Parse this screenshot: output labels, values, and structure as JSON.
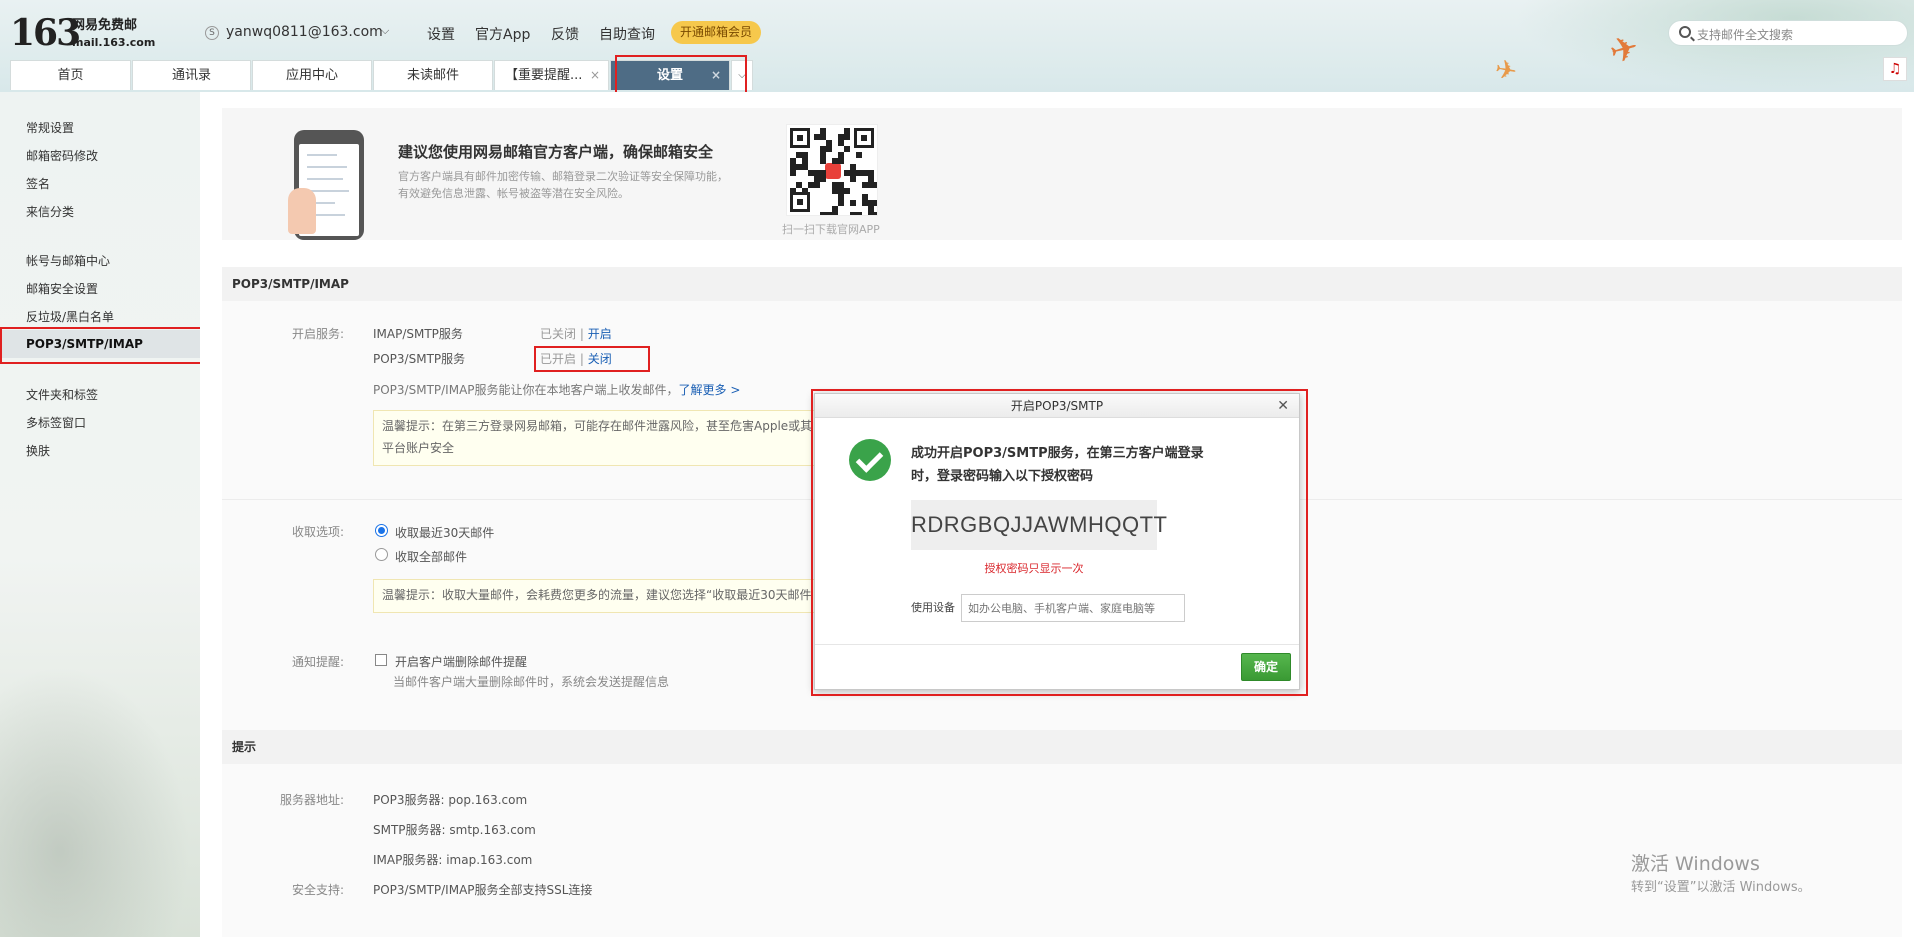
{
  "header": {
    "logo_num": "163",
    "logo_text": "网易免费邮",
    "logo_sub": "mail.163.com",
    "account": "yanwq0811@163.com",
    "links": [
      "设置",
      "官方App",
      "反馈",
      "自助查询"
    ],
    "vip_button": "开通邮箱会员",
    "search_placeholder": "支持邮件全文搜索"
  },
  "tabs": [
    {
      "label": "首页"
    },
    {
      "label": "通讯录"
    },
    {
      "label": "应用中心"
    },
    {
      "label": "未读邮件"
    },
    {
      "label": "【重要提醒..."
    },
    {
      "label": "设置"
    }
  ],
  "sidebar": {
    "group1": [
      "常规设置",
      "邮箱密码修改",
      "签名",
      "来信分类"
    ],
    "group2": [
      "帐号与邮箱中心",
      "邮箱安全设置",
      "反垃圾/黑白名单",
      "POP3/SMTP/IMAP"
    ],
    "group3": [
      "文件夹和标签",
      "多标签窗口",
      "换肤"
    ]
  },
  "banner": {
    "title": "建议您使用网易邮箱官方客户端，确保邮箱安全",
    "desc": "官方客户端具有邮件加密传输、邮箱登录二次验证等安全保障功能，有效避免信息泄露、帐号被盗等潜在安全风险。",
    "qr_caption": "扫一扫下载官网APP"
  },
  "pop": {
    "heading": "POP3/SMTP/IMAP",
    "enable_label": "开启服务:",
    "imap_service": "IMAP/SMTP服务",
    "imap_status": "已关闭",
    "imap_action": "开启",
    "pop3_service": "POP3/SMTP服务",
    "pop3_status": "已开启",
    "pop3_action": "关闭",
    "separator": "|",
    "info": "POP3/SMTP/IMAP服务能让你在本地客户端上收发邮件，",
    "learn_more": "了解更多 >",
    "tip1_line1": "温馨提示：在第三方登录网易邮箱，可能存在邮件泄露风险，甚至危害Apple或其",
    "tip1_line2": "平台账户安全",
    "receive_label": "收取选项:",
    "receive_opt1": "收取最近30天邮件",
    "receive_opt2": "收取全部邮件",
    "tip2": "温馨提示：收取大量邮件，会耗费您更多的流量，建议您选择“收取最近30天邮件",
    "notify_label": "通知提醒:",
    "notify_opt": "开启客户端删除邮件提醒",
    "notify_desc": "当邮件客户端大量删除邮件时，系统会发送提醒信息"
  },
  "hints": {
    "heading": "提示",
    "server_label": "服务器地址:",
    "pop3_server": "POP3服务器: pop.163.com",
    "smtp_server": "SMTP服务器: smtp.163.com",
    "imap_server": "IMAP服务器: imap.163.com",
    "ssl_label": "安全支持:",
    "ssl_text": "POP3/SMTP/IMAP服务全部支持SSL连接"
  },
  "dialog": {
    "title": "开启POP3/SMTP",
    "message": "成功开启POP3/SMTP服务，在第三方客户端登录时，登录密码输入以下授权密码",
    "auth_code": "RDRGBQJJAWMHQQTT",
    "code_note": "授权密码只显示一次",
    "device_label": "使用设备",
    "device_placeholder": "如办公电脑、手机客户端、家庭电脑等",
    "ok_button": "确定"
  },
  "watermark": {
    "line1": "激活 Windows",
    "line2": "转到“设置”以激活 Windows。"
  },
  "icons": {
    "search": "search-icon",
    "music": "music-note-icon",
    "close": "close-icon",
    "check": "check-circle-icon"
  }
}
